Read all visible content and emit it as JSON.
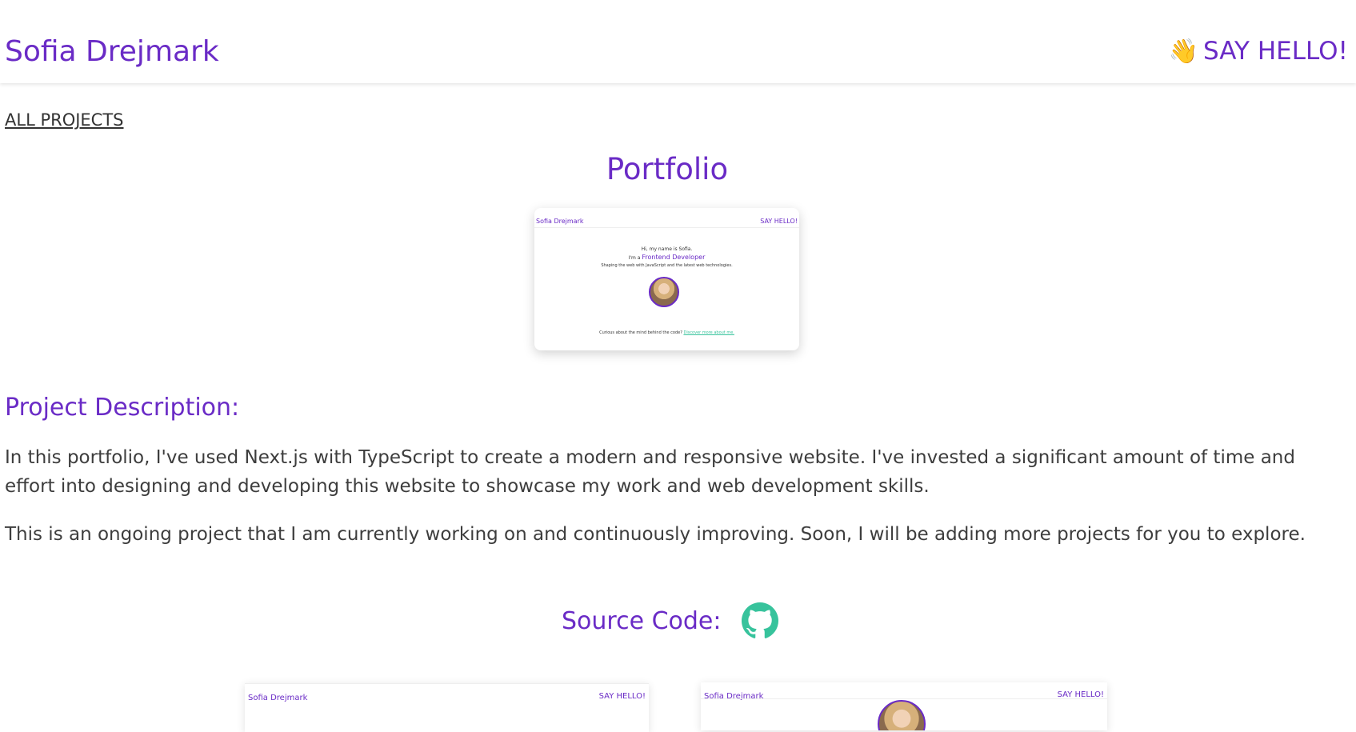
{
  "header": {
    "brand": "Sofia Drejmark",
    "say_hello": "SAY HELLO!",
    "wave_icon": "👋"
  },
  "nav": {
    "all_projects": "ALL PROJECTS"
  },
  "project": {
    "title": "Portfolio",
    "preview": {
      "brand": "Sofia Drejmark",
      "hello": "SAY HELLO!",
      "line1": "Hi, my name is Sofia.",
      "line2_pre": "I'm a ",
      "line2_accent": "Frontend Developer",
      "line3_pre": "Shaping the web with ",
      "line3_accent": "JavaScript",
      "line3_post": " and the latest web technologies.",
      "footer_text": "Curious about the mind behind the code? ",
      "footer_link": "Discover more about me."
    }
  },
  "description": {
    "heading": "Project Description:",
    "paragraphs": [
      "In this portfolio, I've used Next.js with TypeScript to create a modern and responsive website. I've invested a significant amount of time and effort into designing and developing this website to showcase my work and web development skills.",
      "This is an ongoing project that I am currently working on and continuously improving. Soon, I will be adding more projects for you to explore."
    ]
  },
  "source": {
    "label": "Source Code:",
    "icon": "github-icon",
    "icon_color": "#37c39c"
  },
  "thumbnails": [
    {
      "brand": "Sofia Drejmark",
      "hello": "SAY HELLO!"
    },
    {
      "brand": "Sofia Drejmark",
      "hello": "SAY HELLO!"
    }
  ],
  "colors": {
    "accent": "#6a2bc6",
    "link_green": "#37c39c",
    "text": "#3d3d3d"
  }
}
